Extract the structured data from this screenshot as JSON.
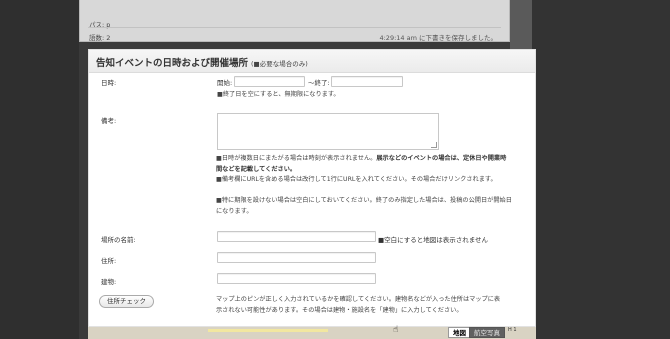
{
  "editor": {
    "path_label": "パス: p",
    "word_count": "語数: 2",
    "autosave": "4:29:14 am に下書きを保存しました。"
  },
  "panel": {
    "title": "告知イベントの日時および開催場所",
    "title_note": "(■必要な場合のみ)"
  },
  "fields": {
    "datetime": {
      "label": "日時:",
      "start_label": "開始:",
      "end_label": "〜終了:",
      "start_value": "",
      "end_value": "",
      "hint": "■終了日を空にすると、無期限になります。"
    },
    "notes": {
      "label": "備考:",
      "value": "",
      "hint1": "■日時が複数日にまたがる場合は時刻が表示されません。",
      "hint1_bold": "展示などのイベントの場合は、定休日や開業時間などを記載してください。",
      "hint2": "■備考欄にURLを含める場合は改行して1行にURLを入れてください。その場合だけリンクされます。",
      "hint3": "■特に期限を設けない場合は空白にしておいてください。終了のみ指定した場合は、投稿の公開日が開始日になります。"
    },
    "place_name": {
      "label": "場所の名前:",
      "value": "",
      "hint": "■空白にすると地図は表示されません"
    },
    "address": {
      "label": "住所:",
      "value": ""
    },
    "building": {
      "label": "建物:",
      "value": ""
    },
    "check_address": {
      "button_label": "住所チェック",
      "hint": "マップ上のピンが正しく入力されているかを確認してください。建物名などが入った住所はマップに表示されない可能性があります。その場合は建物・施設名を「建物」に入力してください。"
    }
  },
  "map": {
    "map_button": "地図",
    "satellite_button": "航空写真",
    "scale_text": "H 1",
    "cursor_icon": "hand-cursor-icon"
  }
}
